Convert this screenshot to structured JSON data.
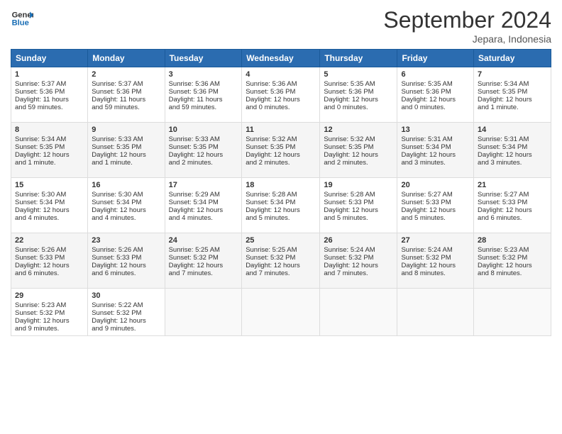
{
  "header": {
    "logo_line1": "General",
    "logo_line2": "Blue",
    "month_title": "September 2024",
    "subtitle": "Jepara, Indonesia"
  },
  "weekdays": [
    "Sunday",
    "Monday",
    "Tuesday",
    "Wednesday",
    "Thursday",
    "Friday",
    "Saturday"
  ],
  "weeks": [
    [
      {
        "day": "1",
        "lines": [
          "Sunrise: 5:37 AM",
          "Sunset: 5:36 PM",
          "Daylight: 11 hours",
          "and 59 minutes."
        ]
      },
      {
        "day": "2",
        "lines": [
          "Sunrise: 5:37 AM",
          "Sunset: 5:36 PM",
          "Daylight: 11 hours",
          "and 59 minutes."
        ]
      },
      {
        "day": "3",
        "lines": [
          "Sunrise: 5:36 AM",
          "Sunset: 5:36 PM",
          "Daylight: 11 hours",
          "and 59 minutes."
        ]
      },
      {
        "day": "4",
        "lines": [
          "Sunrise: 5:36 AM",
          "Sunset: 5:36 PM",
          "Daylight: 12 hours",
          "and 0 minutes."
        ]
      },
      {
        "day": "5",
        "lines": [
          "Sunrise: 5:35 AM",
          "Sunset: 5:36 PM",
          "Daylight: 12 hours",
          "and 0 minutes."
        ]
      },
      {
        "day": "6",
        "lines": [
          "Sunrise: 5:35 AM",
          "Sunset: 5:36 PM",
          "Daylight: 12 hours",
          "and 0 minutes."
        ]
      },
      {
        "day": "7",
        "lines": [
          "Sunrise: 5:34 AM",
          "Sunset: 5:35 PM",
          "Daylight: 12 hours",
          "and 1 minute."
        ]
      }
    ],
    [
      {
        "day": "8",
        "lines": [
          "Sunrise: 5:34 AM",
          "Sunset: 5:35 PM",
          "Daylight: 12 hours",
          "and 1 minute."
        ]
      },
      {
        "day": "9",
        "lines": [
          "Sunrise: 5:33 AM",
          "Sunset: 5:35 PM",
          "Daylight: 12 hours",
          "and 1 minute."
        ]
      },
      {
        "day": "10",
        "lines": [
          "Sunrise: 5:33 AM",
          "Sunset: 5:35 PM",
          "Daylight: 12 hours",
          "and 2 minutes."
        ]
      },
      {
        "day": "11",
        "lines": [
          "Sunrise: 5:32 AM",
          "Sunset: 5:35 PM",
          "Daylight: 12 hours",
          "and 2 minutes."
        ]
      },
      {
        "day": "12",
        "lines": [
          "Sunrise: 5:32 AM",
          "Sunset: 5:35 PM",
          "Daylight: 12 hours",
          "and 2 minutes."
        ]
      },
      {
        "day": "13",
        "lines": [
          "Sunrise: 5:31 AM",
          "Sunset: 5:34 PM",
          "Daylight: 12 hours",
          "and 3 minutes."
        ]
      },
      {
        "day": "14",
        "lines": [
          "Sunrise: 5:31 AM",
          "Sunset: 5:34 PM",
          "Daylight: 12 hours",
          "and 3 minutes."
        ]
      }
    ],
    [
      {
        "day": "15",
        "lines": [
          "Sunrise: 5:30 AM",
          "Sunset: 5:34 PM",
          "Daylight: 12 hours",
          "and 4 minutes."
        ]
      },
      {
        "day": "16",
        "lines": [
          "Sunrise: 5:30 AM",
          "Sunset: 5:34 PM",
          "Daylight: 12 hours",
          "and 4 minutes."
        ]
      },
      {
        "day": "17",
        "lines": [
          "Sunrise: 5:29 AM",
          "Sunset: 5:34 PM",
          "Daylight: 12 hours",
          "and 4 minutes."
        ]
      },
      {
        "day": "18",
        "lines": [
          "Sunrise: 5:28 AM",
          "Sunset: 5:34 PM",
          "Daylight: 12 hours",
          "and 5 minutes."
        ]
      },
      {
        "day": "19",
        "lines": [
          "Sunrise: 5:28 AM",
          "Sunset: 5:33 PM",
          "Daylight: 12 hours",
          "and 5 minutes."
        ]
      },
      {
        "day": "20",
        "lines": [
          "Sunrise: 5:27 AM",
          "Sunset: 5:33 PM",
          "Daylight: 12 hours",
          "and 5 minutes."
        ]
      },
      {
        "day": "21",
        "lines": [
          "Sunrise: 5:27 AM",
          "Sunset: 5:33 PM",
          "Daylight: 12 hours",
          "and 6 minutes."
        ]
      }
    ],
    [
      {
        "day": "22",
        "lines": [
          "Sunrise: 5:26 AM",
          "Sunset: 5:33 PM",
          "Daylight: 12 hours",
          "and 6 minutes."
        ]
      },
      {
        "day": "23",
        "lines": [
          "Sunrise: 5:26 AM",
          "Sunset: 5:33 PM",
          "Daylight: 12 hours",
          "and 6 minutes."
        ]
      },
      {
        "day": "24",
        "lines": [
          "Sunrise: 5:25 AM",
          "Sunset: 5:32 PM",
          "Daylight: 12 hours",
          "and 7 minutes."
        ]
      },
      {
        "day": "25",
        "lines": [
          "Sunrise: 5:25 AM",
          "Sunset: 5:32 PM",
          "Daylight: 12 hours",
          "and 7 minutes."
        ]
      },
      {
        "day": "26",
        "lines": [
          "Sunrise: 5:24 AM",
          "Sunset: 5:32 PM",
          "Daylight: 12 hours",
          "and 7 minutes."
        ]
      },
      {
        "day": "27",
        "lines": [
          "Sunrise: 5:24 AM",
          "Sunset: 5:32 PM",
          "Daylight: 12 hours",
          "and 8 minutes."
        ]
      },
      {
        "day": "28",
        "lines": [
          "Sunrise: 5:23 AM",
          "Sunset: 5:32 PM",
          "Daylight: 12 hours",
          "and 8 minutes."
        ]
      }
    ],
    [
      {
        "day": "29",
        "lines": [
          "Sunrise: 5:23 AM",
          "Sunset: 5:32 PM",
          "Daylight: 12 hours",
          "and 9 minutes."
        ]
      },
      {
        "day": "30",
        "lines": [
          "Sunrise: 5:22 AM",
          "Sunset: 5:32 PM",
          "Daylight: 12 hours",
          "and 9 minutes."
        ]
      },
      {
        "day": "",
        "lines": []
      },
      {
        "day": "",
        "lines": []
      },
      {
        "day": "",
        "lines": []
      },
      {
        "day": "",
        "lines": []
      },
      {
        "day": "",
        "lines": []
      }
    ]
  ]
}
